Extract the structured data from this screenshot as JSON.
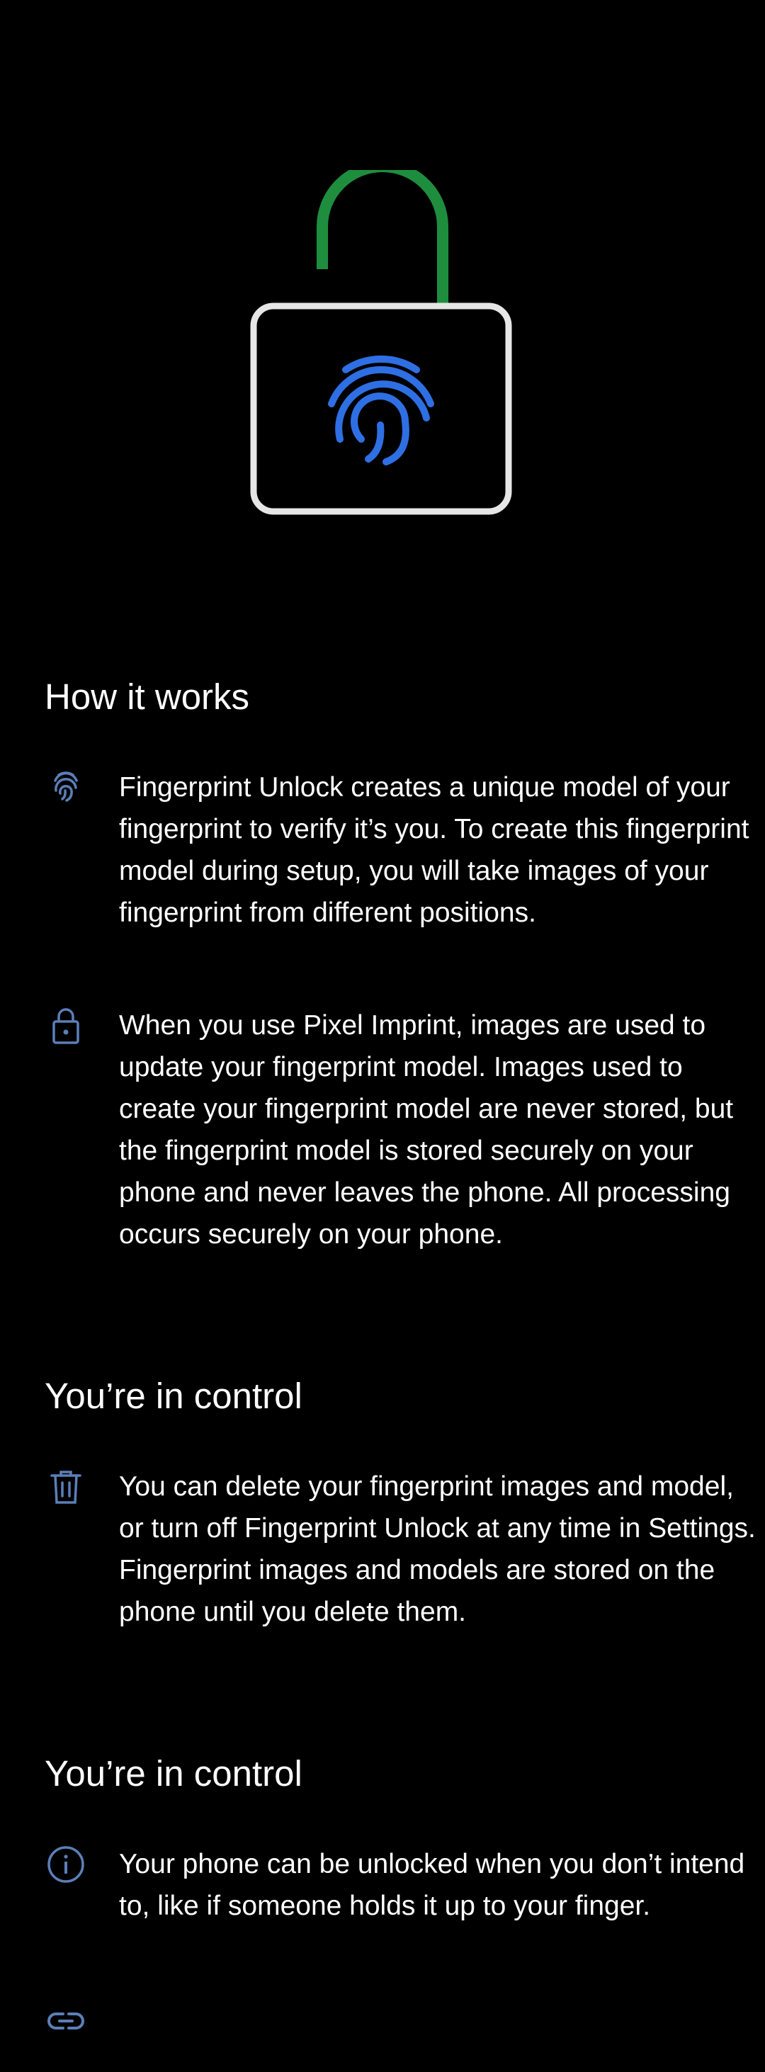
{
  "colors": {
    "background": "#000000",
    "text": "#ffffff",
    "accent_blue": "#2f6fe4",
    "icon_blue": "#5b7fb8",
    "shackle_green": "#1e8e3e",
    "lock_body_border": "#e6e6e6"
  },
  "hero": {
    "icon": "lock-open-fingerprint-icon"
  },
  "sections": [
    {
      "title": "How it works",
      "items": [
        {
          "icon": "fingerprint-icon",
          "text": "Fingerprint Unlock creates a unique model of your fingerprint to verify it’s you. To create this fingerprint model during setup, you will take images of your fingerprint from different positions."
        },
        {
          "icon": "lock-icon",
          "text": "When you use Pixel Imprint, images are used to update your fingerprint model. Images used to create your fingerprint model are never stored, but the fingerprint model is stored securely on your phone and never leaves the phone. All processing occurs securely on your phone."
        }
      ]
    },
    {
      "title": "You’re in control",
      "items": [
        {
          "icon": "trash-icon",
          "text": "You can delete your fingerprint images and model, or turn off Fingerprint Unlock at any time in Settings. Fingerprint images and models are stored on the phone until you delete them."
        }
      ]
    },
    {
      "title": "You’re in control",
      "items": [
        {
          "icon": "info-icon",
          "text": "Your phone can be unlocked when you don’t intend to, like if someone holds it up to your finger."
        },
        {
          "icon": "link-icon",
          "text": ""
        }
      ]
    }
  ]
}
